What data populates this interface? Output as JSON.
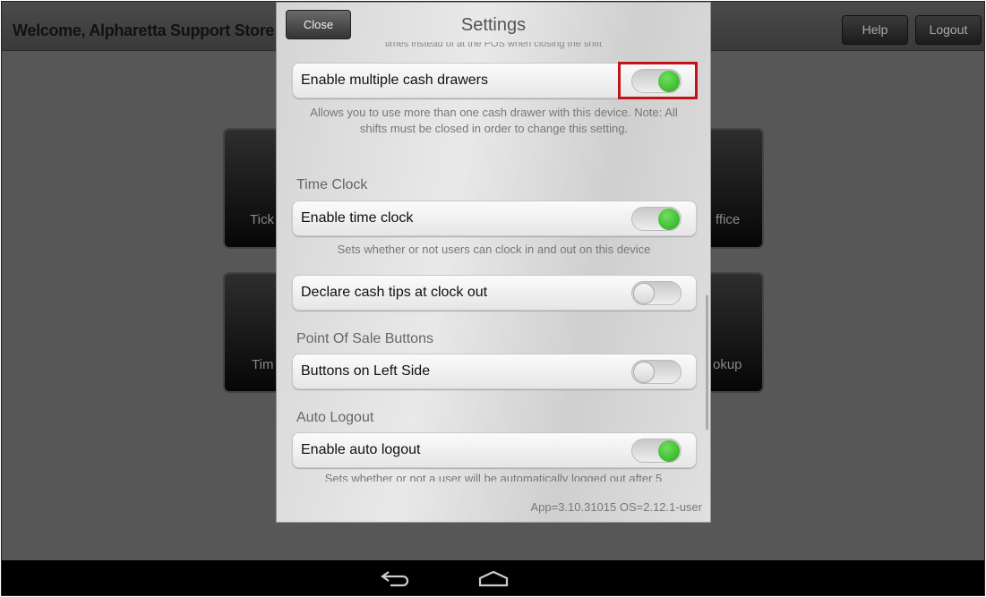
{
  "header": {
    "welcome": "Welcome, Alpharetta Support Store",
    "help": "Help",
    "logout": "Logout"
  },
  "tiles": [
    {
      "label": "Tick"
    },
    {
      "label": "ffice"
    },
    {
      "label": "Tim"
    },
    {
      "label": "okup"
    }
  ],
  "modal": {
    "close": "Close",
    "title": "Settings",
    "top_cut": "times instead of at the POS when closing the shift",
    "rows": [
      {
        "label": "Enable multiple cash drawers",
        "on": true,
        "desc": "Allows you to use more than one cash drawer with this device. Note: All shifts must be closed in order to change this setting."
      },
      {
        "section": "Time Clock",
        "label": "Enable time clock",
        "on": true,
        "desc": "Sets whether or not users can clock in and out on this device"
      },
      {
        "label": "Declare cash tips at clock out",
        "on": false
      },
      {
        "section": "Point Of Sale Buttons",
        "label": "Buttons on Left Side",
        "on": false
      },
      {
        "section": "Auto Logout",
        "label": "Enable auto logout",
        "on": true,
        "desc": "Sets whether or not a user will be automatically logged out after 5"
      }
    ],
    "version": "App=3.10.31015 OS=2.12.1-user"
  },
  "highlight_color": "#c0141a",
  "toggle_on_color": "#3cc22e",
  "nav": {
    "back": "back-icon",
    "home": "home-icon"
  }
}
